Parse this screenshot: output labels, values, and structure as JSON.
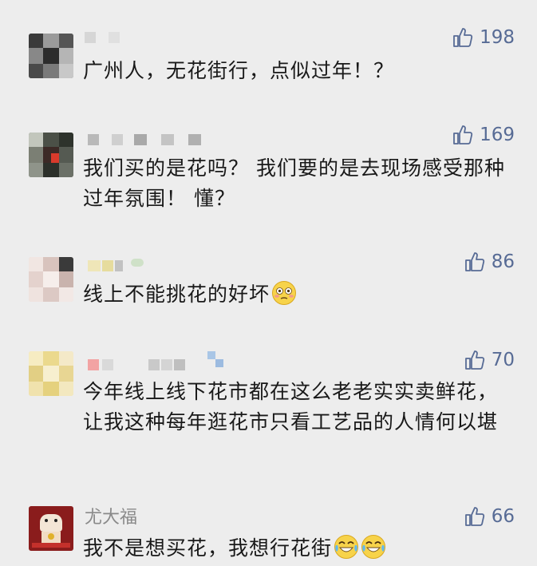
{
  "comments": [
    {
      "author": "",
      "likes": "198",
      "text": "广州人，无花街行，点似过年！？",
      "emoji": []
    },
    {
      "author": "",
      "likes": "169",
      "text": "我们买的是花吗？ 我们要的是去现场感受那种过年氛围！ 懂？",
      "emoji": []
    },
    {
      "author": "",
      "likes": "86",
      "text": "线上不能挑花的好坏",
      "emoji": [
        "flushed-face"
      ]
    },
    {
      "author": "",
      "likes": "70",
      "text": "今年线上线下花市都在这么老老实实卖鲜花，让我这种每年逛花市只看工艺品的人情何以堪",
      "emoji": []
    },
    {
      "author": "尤大福",
      "likes": "66",
      "text": "我不是想买花，我想行花街",
      "emoji": [
        "tears-of-joy",
        "tears-of-joy"
      ]
    }
  ],
  "colors": {
    "background": "#ededed",
    "like": "#576b95",
    "text": "#191919",
    "author": "#8a8a8a"
  }
}
